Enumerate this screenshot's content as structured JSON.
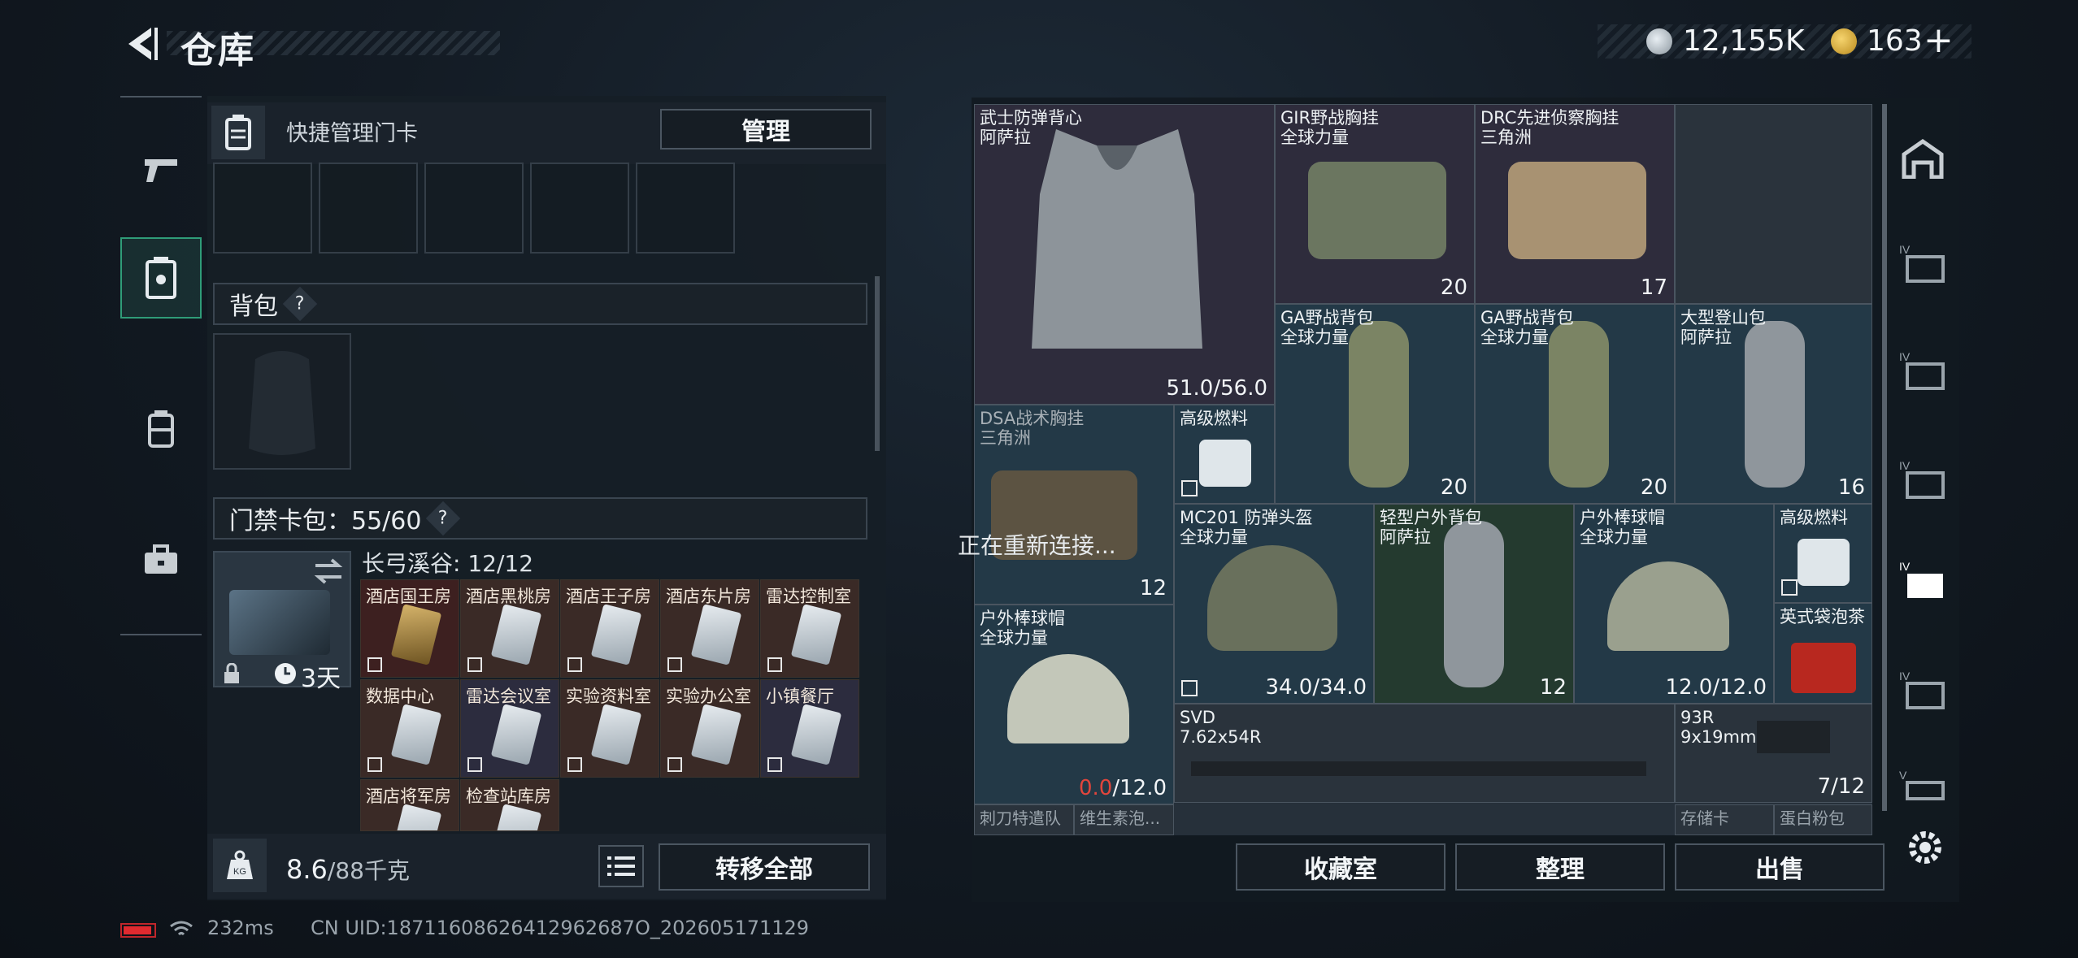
{
  "header": {
    "title": "仓库",
    "money": "12,155K",
    "coupon": "163",
    "plus": "+"
  },
  "left": {
    "keycard_bar": "快捷管理门卡",
    "manage_label": "管理",
    "backpack_label": "背包",
    "keycard_bag_label": "门禁卡包：55/60",
    "help": "?",
    "region_label": "长弓溪谷: 12/12",
    "card_timer": "3天",
    "keycards": [
      "酒店国王房",
      "酒店黑桃房",
      "酒店王子房",
      "酒店东片房",
      "雷达控制室",
      "数据中心",
      "雷达会议室",
      "实验资料室",
      "实验办公室",
      "小镇餐厅",
      "酒店将军房",
      "检查站库房"
    ],
    "weight": "8.6",
    "weight_max": "/88千克",
    "transfer_label": "转移全部"
  },
  "right": {
    "items": [
      {
        "name": "武士防弹背心\n阿萨拉",
        "value": "51.0/56.0"
      },
      {
        "name": "GIR野战胸挂\n全球力量",
        "value": "20"
      },
      {
        "name": "DRC先进侦察胸挂\n三角洲",
        "value": "17"
      },
      {
        "name": "GA野战背包\n全球力量",
        "value": "20"
      },
      {
        "name": "GA野战背包\n全球力量",
        "value": "20"
      },
      {
        "name": "大型登山包\n阿萨拉",
        "value": "16"
      },
      {
        "name": "DSA战术胸挂\n三角洲",
        "value": "12"
      },
      {
        "name": "高级燃料",
        "value": ""
      },
      {
        "name": "MC201 防弹头盔\n全球力量",
        "value": "34.0/34.0"
      },
      {
        "name": "轻型户外背包\n阿萨拉",
        "value": "12"
      },
      {
        "name": "户外棒球帽\n全球力量",
        "value": "12.0/12.0"
      },
      {
        "name": "高级燃料",
        "value": ""
      },
      {
        "name": "户外棒球帽\n全球力量",
        "value_red": "0.0",
        "value_rest": "/12.0"
      },
      {
        "name": "英式袋泡茶",
        "value": ""
      },
      {
        "name": "SVD\n7.62x54R",
        "value": ""
      },
      {
        "name": "93R\n9x19mm",
        "value": "7/12"
      },
      {
        "name": "刺刀特遣队",
        "value": ""
      },
      {
        "name": "维生素泡...",
        "value": ""
      },
      {
        "name": "存储卡",
        "value": ""
      },
      {
        "name": "蛋白粉包",
        "value": ""
      }
    ],
    "reconnect": "正在重新连接...",
    "buttons": {
      "collection": "收藏室",
      "sort": "整理",
      "sell": "出售"
    }
  },
  "status": {
    "ping": "232ms",
    "uid": "CN UID:18711608626412962687O_202605171129"
  },
  "colors": {
    "accent": "#2f9c78",
    "battery": "#e02a2f",
    "value_red": "#e2453c"
  }
}
